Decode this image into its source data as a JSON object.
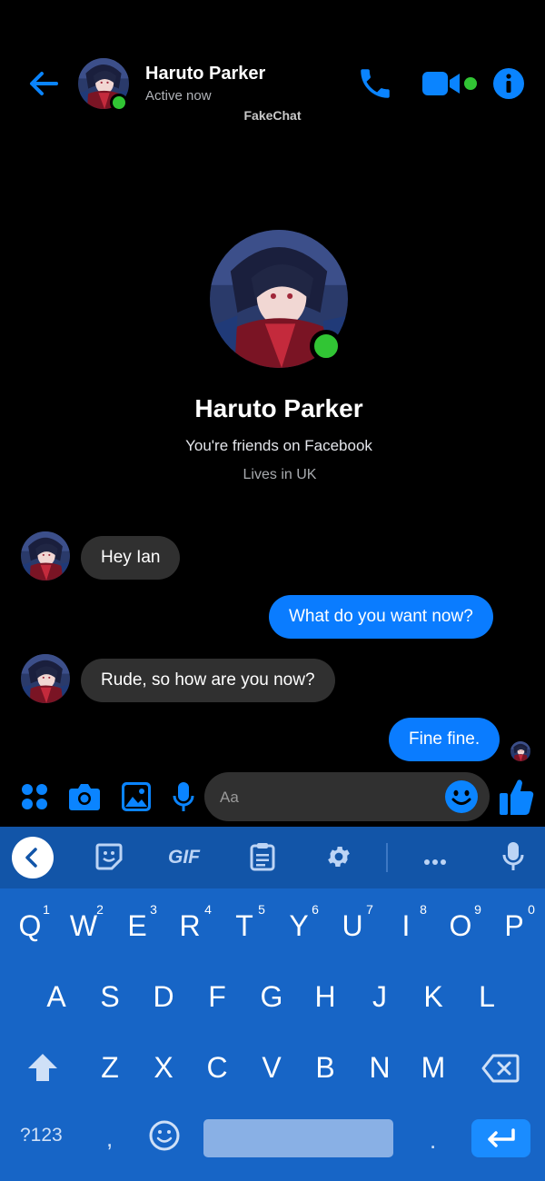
{
  "header": {
    "contact_name": "Haruto Parker",
    "status": "Active now",
    "brand": "FakeChat"
  },
  "profile": {
    "name": "Haruto Parker",
    "friends_text": "You're friends on Facebook",
    "location_text": "Lives in UK"
  },
  "messages": [
    {
      "from": "them",
      "text": "Hey Ian"
    },
    {
      "from": "me",
      "text": "What do you want now?"
    },
    {
      "from": "them",
      "text": "Rude, so how are you now?"
    },
    {
      "from": "me",
      "text": "Fine fine."
    }
  ],
  "composer": {
    "placeholder": "Aa"
  },
  "keyboard": {
    "toolbar": [
      "back",
      "sticker",
      "GIF",
      "clipboard",
      "settings",
      "more",
      "mic"
    ],
    "gif_label": "GIF",
    "row1": [
      "Q",
      "W",
      "E",
      "R",
      "T",
      "Y",
      "U",
      "I",
      "O",
      "P"
    ],
    "row1_numbers": [
      "1",
      "2",
      "3",
      "4",
      "5",
      "6",
      "7",
      "8",
      "9",
      "0"
    ],
    "row2": [
      "A",
      "S",
      "D",
      "F",
      "G",
      "H",
      "J",
      "K",
      "L"
    ],
    "row3": [
      "Z",
      "X",
      "C",
      "V",
      "B",
      "N",
      "M"
    ],
    "symbols_label": "?123",
    "comma": ",",
    "period": "."
  },
  "colors": {
    "accent": "#0a7cff",
    "online": "#31c534",
    "incoming_bubble": "#303030",
    "keyboard_bg": "#1765c6",
    "keyboard_toolbar": "#1255a8",
    "enter_key": "#1a8cff"
  }
}
